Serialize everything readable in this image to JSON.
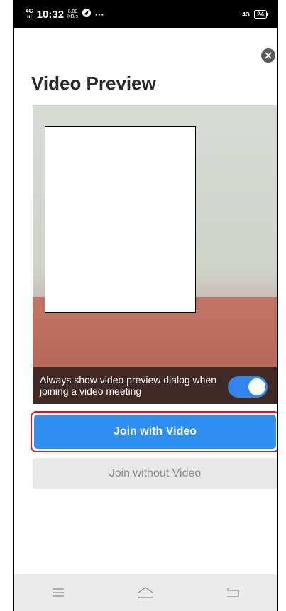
{
  "status_bar": {
    "network_tag_top": "4G",
    "network_tag_bottom": "ııl",
    "time": "10:32",
    "speed_value": "0.00",
    "speed_unit": "KB/s",
    "dots": "···",
    "right_network": "4G",
    "battery": "24"
  },
  "dialog": {
    "title": "Video Preview",
    "preview_toggle_label": "Always show video preview dialog when joining a video meeting",
    "preview_toggle_on": true,
    "join_with_video_label": "Join with Video",
    "join_without_video_label": "Join without Video"
  },
  "icons": {
    "close": "close-icon",
    "menu": "menu-icon",
    "home": "home-icon",
    "back": "back-icon"
  },
  "colors": {
    "accent": "#2d8ef0",
    "highlight_border": "#d71920",
    "toggle_on": "#2f86f0"
  }
}
